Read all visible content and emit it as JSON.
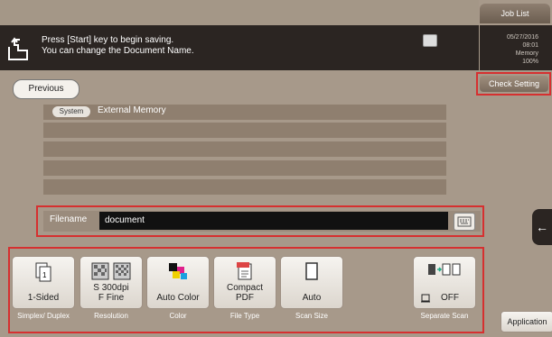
{
  "header": {
    "job_list_label": "Job List",
    "message_line1": "Press [Start] key to begin saving.",
    "message_line2": "You can change the Document Name.",
    "date": "05/27/2016",
    "time": "08:01",
    "memory_label": "Memory",
    "memory_value": "100%"
  },
  "nav": {
    "previous_label": "Previous",
    "check_setting_label": "Check Setting"
  },
  "list": {
    "badge": "System",
    "item_name": "External Memory"
  },
  "filename": {
    "label": "Filename",
    "value": "document"
  },
  "functions": [
    {
      "label": "1-Sided",
      "caption": "Simplex/ Duplex",
      "icon": "simplex-icon"
    },
    {
      "label": "S 300dpi F Fine",
      "caption": "Resolution",
      "icon": "resolution-icon"
    },
    {
      "label": "Auto Color",
      "caption": "Color",
      "icon": "color-icon"
    },
    {
      "label": "Compact PDF",
      "caption": "File Type",
      "icon": "pdf-icon"
    },
    {
      "label": "Auto",
      "caption": "Scan Size",
      "icon": "page-icon"
    },
    {
      "label": "OFF",
      "caption": "Separate Scan",
      "icon": "separate-scan-icon"
    }
  ],
  "application_label": "Application"
}
